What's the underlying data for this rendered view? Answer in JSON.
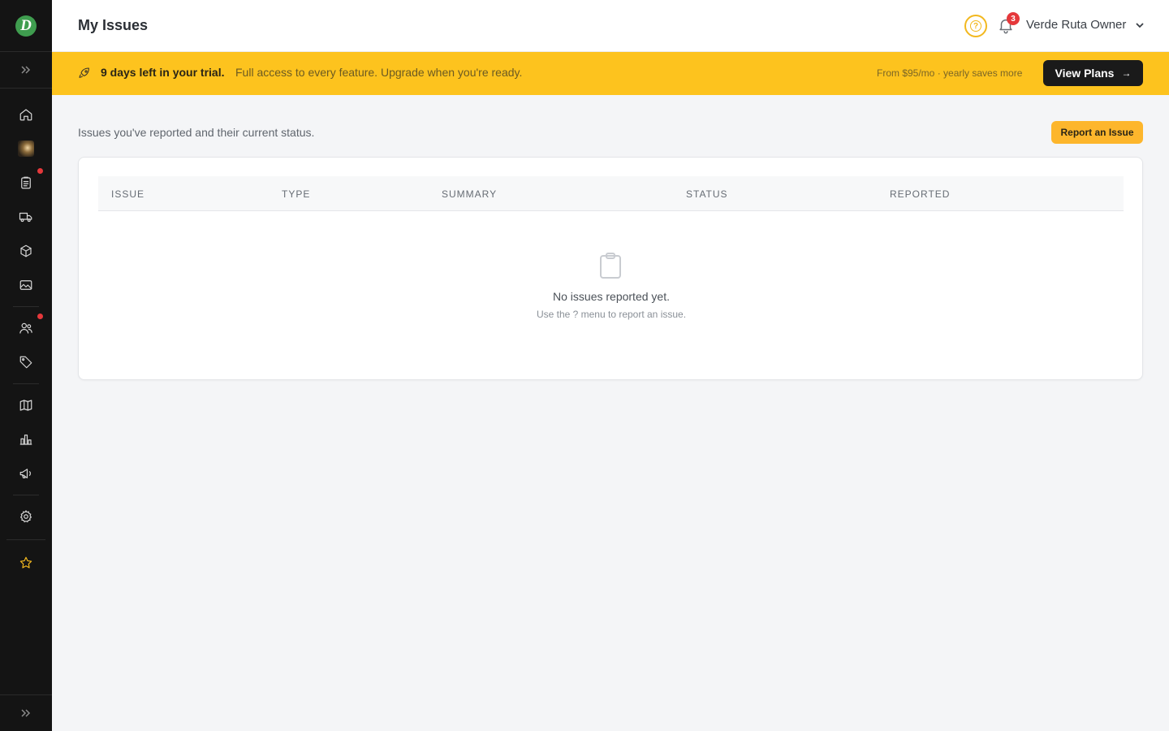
{
  "app": {
    "logo_letter": "D",
    "title": "My Issues"
  },
  "header": {
    "help_icon": "help-icon",
    "notifications": {
      "icon": "bell-icon",
      "count": "3"
    },
    "user": {
      "name": "Verde Ruta Owner"
    }
  },
  "trial_banner": {
    "headline": "9 days left in your trial.",
    "message": "Full access to every feature. Upgrade when you're ready.",
    "price_note": "From $95/mo · yearly saves more",
    "cta_label": "View Plans",
    "cta_arrow": "→"
  },
  "sidebar": {
    "items": [
      {
        "icon": "home-icon"
      },
      {
        "icon": "workspace-avatar"
      },
      {
        "icon": "clipboard-list-icon",
        "notification": true
      },
      {
        "icon": "truck-icon"
      },
      {
        "icon": "box-icon"
      },
      {
        "icon": "image-icon"
      },
      {
        "icon": "users-icon",
        "notification": true
      },
      {
        "icon": "tag-icon"
      },
      {
        "icon": "map-icon"
      },
      {
        "icon": "bar-chart-icon"
      },
      {
        "icon": "megaphone-icon"
      },
      {
        "icon": "settings-icon"
      },
      {
        "icon": "star-icon"
      }
    ]
  },
  "content": {
    "subtitle": "Issues you've reported and their current status.",
    "report_button": "Report an Issue",
    "table": {
      "columns": [
        "ISSUE",
        "TYPE",
        "SUMMARY",
        "STATUS",
        "REPORTED"
      ],
      "rows": []
    },
    "empty_state": {
      "icon": "clipboard-icon",
      "title": "No issues reported yet.",
      "subtitle": "Use the ? menu to report an issue."
    }
  },
  "colors": {
    "sidebar_bg": "#141414",
    "banner_bg": "#fdc31e",
    "accent_button": "#fdb62c",
    "dark_button": "#1a1a1a",
    "notification_red": "#e5383b",
    "logo_green": "#3f9d4f"
  }
}
